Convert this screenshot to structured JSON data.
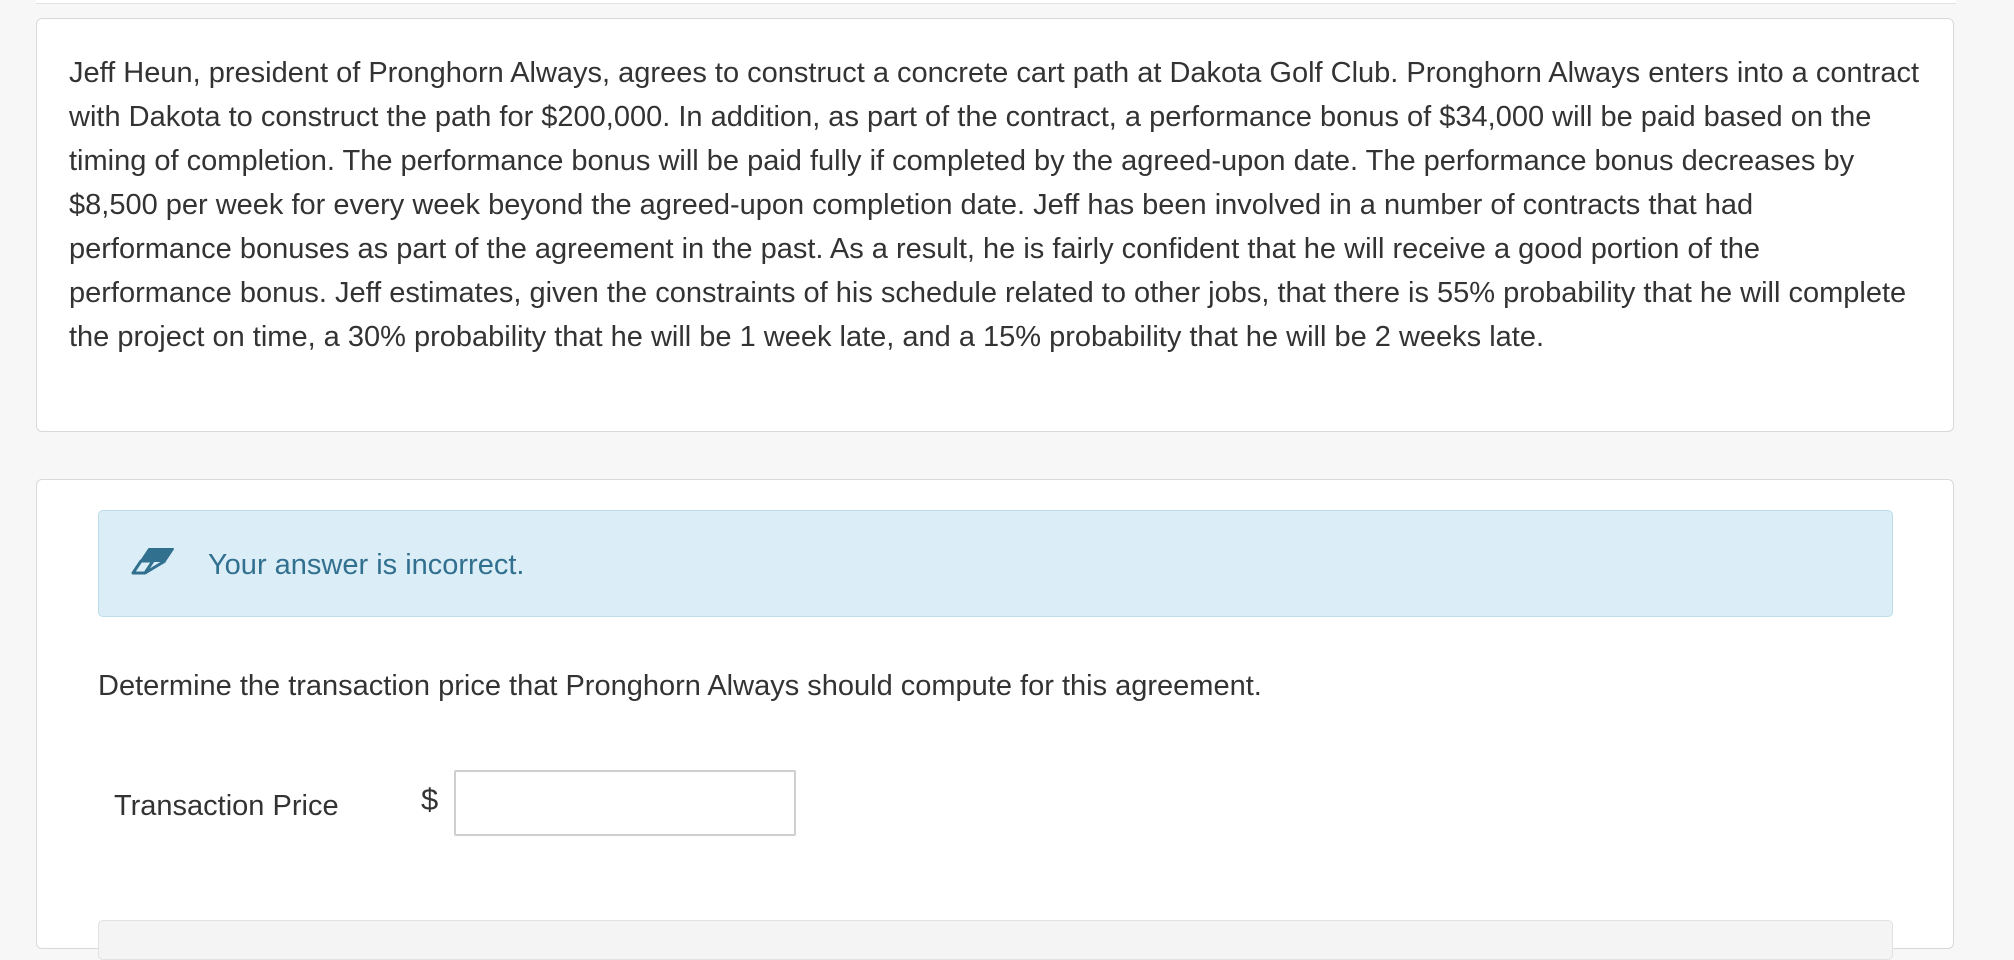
{
  "problem": {
    "text": "Jeff Heun, president of Pronghorn Always, agrees to construct a concrete cart path at Dakota Golf Club. Pronghorn Always enters into a contract with Dakota to construct the path for $200,000. In addition, as part of the contract, a performance bonus of $34,000 will be paid based on the timing of completion. The performance bonus will be paid fully if completed by the agreed-upon date. The performance bonus decreases by $8,500 per week for every week beyond the agreed-upon completion date. Jeff has been involved in a number of contracts that had performance bonuses as part of the agreement in the past. As a result, he is fairly confident that he will receive a good portion of the performance bonus. Jeff estimates, given the constraints of his schedule related to other jobs, that there is 55% probability that he will complete the project on time, a 30% probability that he will be 1 week late, and a 15% probability that he will be 2 weeks late."
  },
  "feedback": {
    "icon": "eraser-icon",
    "text": "Your answer is incorrect."
  },
  "question": {
    "text": "Determine the transaction price that Pronghorn Always should compute for this agreement."
  },
  "answer": {
    "label": "Transaction Price",
    "currency": "$",
    "value": ""
  },
  "colors": {
    "feedback_background": "#dbedf6",
    "feedback_text": "#31708f",
    "card_border": "#d9d9d9",
    "page_background": "#f7f7f7"
  }
}
